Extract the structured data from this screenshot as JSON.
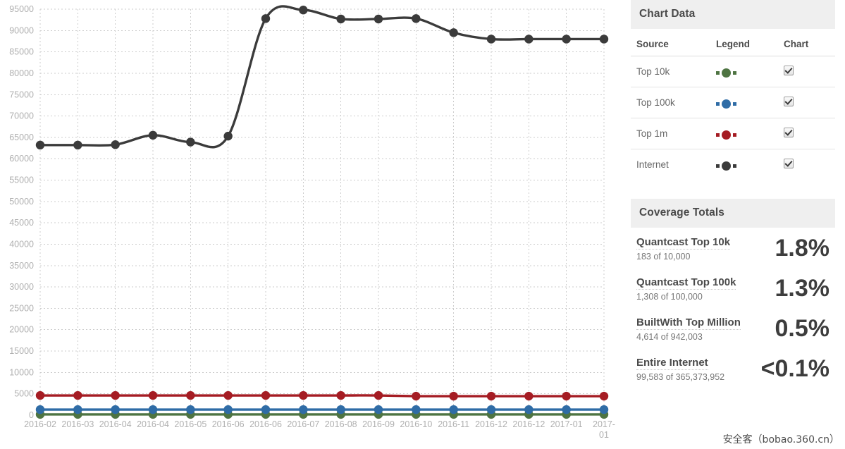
{
  "chart_data": {
    "type": "line",
    "title": "",
    "xlabel": "",
    "ylabel": "",
    "ylim": [
      0,
      95000
    ],
    "ytick_step": 5000,
    "grid": true,
    "legend_position": "sidebar-table",
    "yticks": [
      "95000",
      "90000",
      "85000",
      "80000",
      "75000",
      "70000",
      "65000",
      "60000",
      "55000",
      "50000",
      "45000",
      "40000",
      "35000",
      "30000",
      "25000",
      "20000",
      "15000",
      "10000",
      "5000",
      "0"
    ],
    "categories": [
      "2016-02",
      "2016-03",
      "2016-04",
      "2016-04",
      "2016-05",
      "2016-06",
      "2016-06",
      "2016-07",
      "2016-08",
      "2016-09",
      "2016-10",
      "2016-11",
      "2016-12",
      "2016-12",
      "2017-01",
      "2017-01"
    ],
    "series": [
      {
        "name": "Internet",
        "color": "#3b3b3b",
        "values": [
          63200,
          63200,
          63300,
          65500,
          63900,
          65300,
          92800,
          94800,
          92700,
          92700,
          92800,
          89500,
          88000,
          88000,
          88000,
          88000
        ]
      },
      {
        "name": "Top 1m",
        "color": "#a51c23",
        "values": [
          4614,
          4614,
          4614,
          4614,
          4614,
          4614,
          4614,
          4614,
          4614,
          4614,
          4450,
          4450,
          4450,
          4450,
          4450,
          4450
        ]
      },
      {
        "name": "Top 100k",
        "color": "#2f6ca6",
        "values": [
          1308,
          1308,
          1308,
          1308,
          1308,
          1308,
          1308,
          1308,
          1308,
          1308,
          1308,
          1308,
          1308,
          1308,
          1308,
          1308
        ]
      },
      {
        "name": "Top 10k",
        "color": "#4e7442",
        "values": [
          183,
          183,
          183,
          183,
          183,
          183,
          183,
          183,
          183,
          183,
          183,
          183,
          183,
          183,
          183,
          183
        ]
      }
    ]
  },
  "sidebar": {
    "chart_data_panel": {
      "header": "Chart Data",
      "columns": [
        "Source",
        "Legend",
        "Chart"
      ],
      "rows": [
        {
          "source": "Top 10k",
          "color": "#4e7442",
          "checked": true
        },
        {
          "source": "Top 100k",
          "color": "#2f6ca6",
          "checked": true
        },
        {
          "source": "Top 1m",
          "color": "#a51c23",
          "checked": true
        },
        {
          "source": "Internet",
          "color": "#3b3b3b",
          "checked": true
        }
      ]
    },
    "coverage_panel": {
      "header": "Coverage Totals",
      "rows": [
        {
          "title": "Quantcast Top 10k",
          "detail": "183 of 10,000",
          "percent": "1.8%"
        },
        {
          "title": "Quantcast Top 100k",
          "detail": "1,308 of 100,000",
          "percent": "1.3%"
        },
        {
          "title": "BuiltWith Top Million",
          "detail": "4,614 of 942,003",
          "percent": "0.5%"
        },
        {
          "title": "Entire Internet",
          "detail": "99,583 of 365,373,952",
          "percent": "<0.1%"
        }
      ]
    }
  },
  "watermark": {
    "text": "安全客（bobao.360.cn）"
  },
  "colors": {
    "header_bg": "#efefef",
    "header_text": "#4a4a4a",
    "grid": "#cccccc",
    "axis_text": "#b0b0b0"
  }
}
